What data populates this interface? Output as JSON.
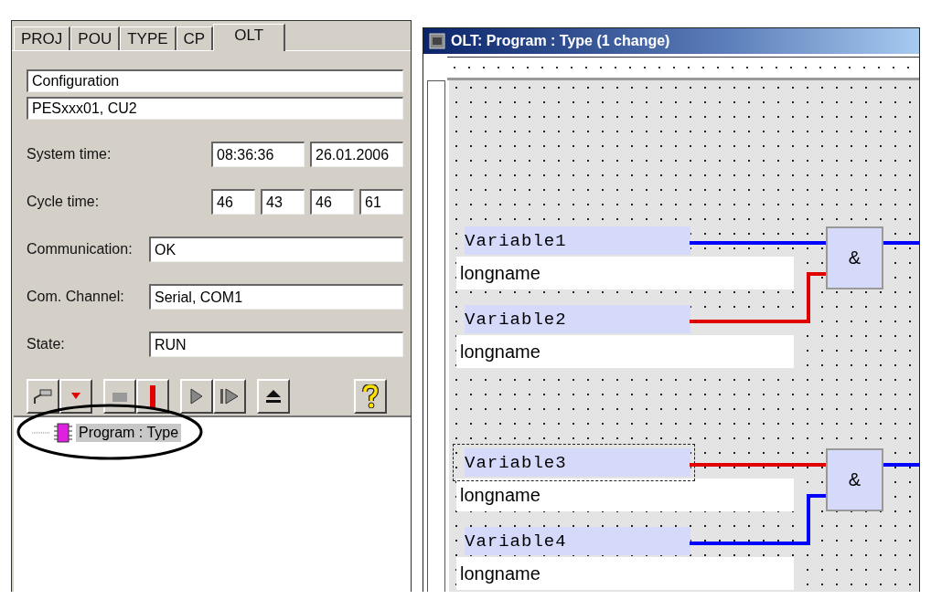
{
  "tabs": [
    {
      "label": "PROJ",
      "selected": false
    },
    {
      "label": "POU",
      "selected": false
    },
    {
      "label": "TYPE",
      "selected": false
    },
    {
      "label": "CP",
      "selected": false
    },
    {
      "label": "OLT",
      "selected": true
    }
  ],
  "config": {
    "name": "Configuration",
    "device": "PESxxx01, CU2"
  },
  "fields": [
    {
      "label": "System time:",
      "values": [
        "08:36:36",
        "26.01.2006"
      ]
    },
    {
      "label": "Cycle time:",
      "values": [
        "46",
        "43",
        "46",
        "61"
      ]
    },
    {
      "label": "Communication:",
      "values": [
        "OK"
      ]
    },
    {
      "label": "Com. Channel:",
      "values": [
        "Serial, COM1"
      ]
    },
    {
      "label": "State:",
      "values": [
        "RUN"
      ]
    }
  ],
  "toolbar": [
    {
      "kind": "connect"
    },
    {
      "kind": "download"
    },
    {
      "kind": "stop"
    },
    {
      "kind": "reset"
    },
    {
      "kind": "run"
    },
    {
      "kind": "step"
    },
    {
      "kind": "eject"
    },
    {
      "kind": "help"
    }
  ],
  "tree": [
    {
      "label": "Program : Type",
      "selected": true
    }
  ],
  "editor": {
    "title": "OLT: Program : Type (1 change)",
    "networks": [
      {
        "gate": "&",
        "output": {
          "color": "#0000ff"
        },
        "inputs": [
          {
            "name": "Variable1",
            "longname": "longname",
            "color": "#0000ff",
            "selected": false
          },
          {
            "name": "Variable2",
            "longname": "longname",
            "color": "#e00000",
            "selected": false
          }
        ]
      },
      {
        "gate": "&",
        "output": {
          "color": "#0000ff"
        },
        "inputs": [
          {
            "name": "Variable3",
            "longname": "longname",
            "color": "#e00000",
            "selected": true
          },
          {
            "name": "Variable4",
            "longname": "longname",
            "color": "#0000ff",
            "selected": false
          }
        ]
      }
    ]
  }
}
